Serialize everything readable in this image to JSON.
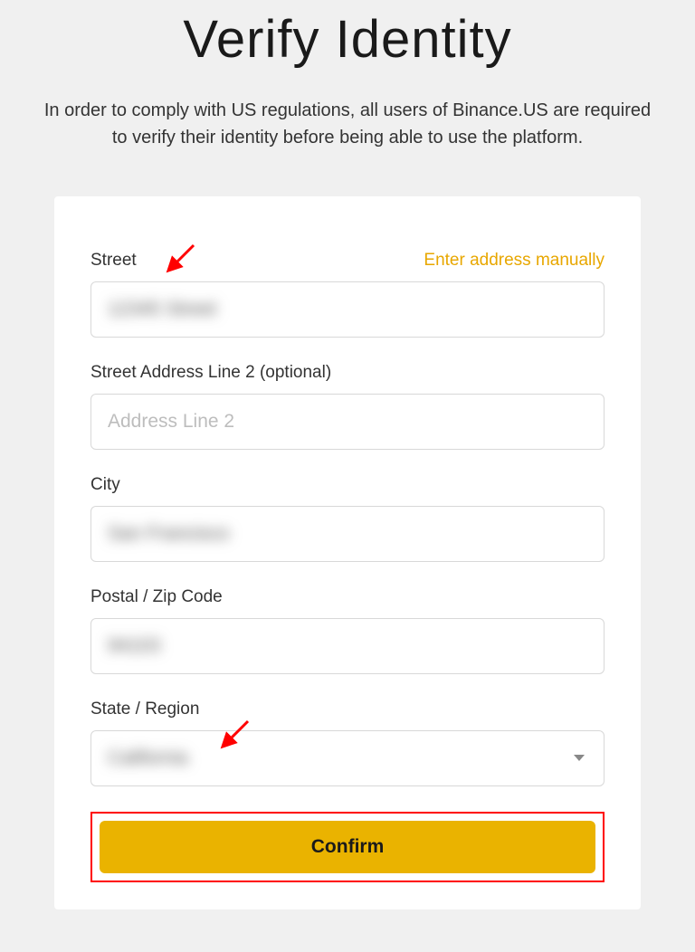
{
  "header": {
    "title": "Verify Identity",
    "subtitle": "In order to comply with US regulations, all users of Binance.US are required to verify their identity before being able to use the platform."
  },
  "form": {
    "manual_link": "Enter address manually",
    "street": {
      "label": "Street",
      "value": "12345 Street"
    },
    "street2": {
      "label": "Street Address Line 2 (optional)",
      "placeholder": "Address Line 2",
      "value": ""
    },
    "city": {
      "label": "City",
      "value": "San Francisco"
    },
    "postal": {
      "label": "Postal / Zip Code",
      "value": "94103"
    },
    "state": {
      "label": "State / Region",
      "value": "California"
    },
    "confirm_label": "Confirm"
  }
}
